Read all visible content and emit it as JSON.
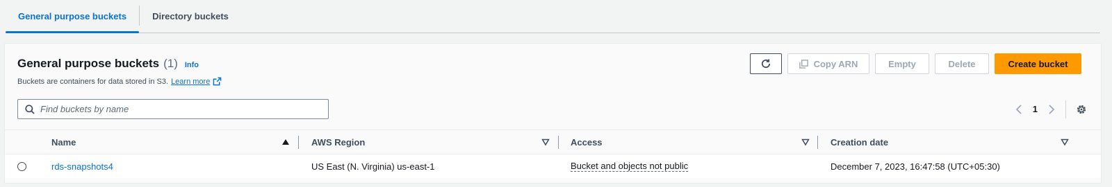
{
  "tabs": [
    {
      "label": "General purpose buckets",
      "active": true
    },
    {
      "label": "Directory buckets",
      "active": false
    }
  ],
  "panel": {
    "title": "General purpose buckets",
    "count": "(1)",
    "info": "Info",
    "description": "Buckets are containers for data stored in S3.",
    "learn_more": "Learn more"
  },
  "actions": {
    "copy_arn": "Copy ARN",
    "empty": "Empty",
    "delete": "Delete",
    "create": "Create bucket"
  },
  "search": {
    "placeholder": "Find buckets by name"
  },
  "pagination": {
    "current_page": "1"
  },
  "table": {
    "columns": [
      "Name",
      "AWS Region",
      "Access",
      "Creation date"
    ],
    "rows": [
      {
        "name": "rds-snapshots4",
        "region": "US East (N. Virginia) us-east-1",
        "access": "Bucket and objects not public",
        "created": "December 7, 2023, 16:47:58 (UTC+05:30)"
      }
    ]
  },
  "colors": {
    "accent": "#0972d3",
    "primary_button": "#ff9900",
    "disabled_text": "#9ba7b6"
  },
  "icons": [
    "refresh-icon",
    "copy-icon",
    "external-link-icon",
    "search-icon",
    "chevron-left-icon",
    "chevron-right-icon",
    "settings-icon",
    "sort-ascending-icon",
    "sort-descending-icon"
  ]
}
